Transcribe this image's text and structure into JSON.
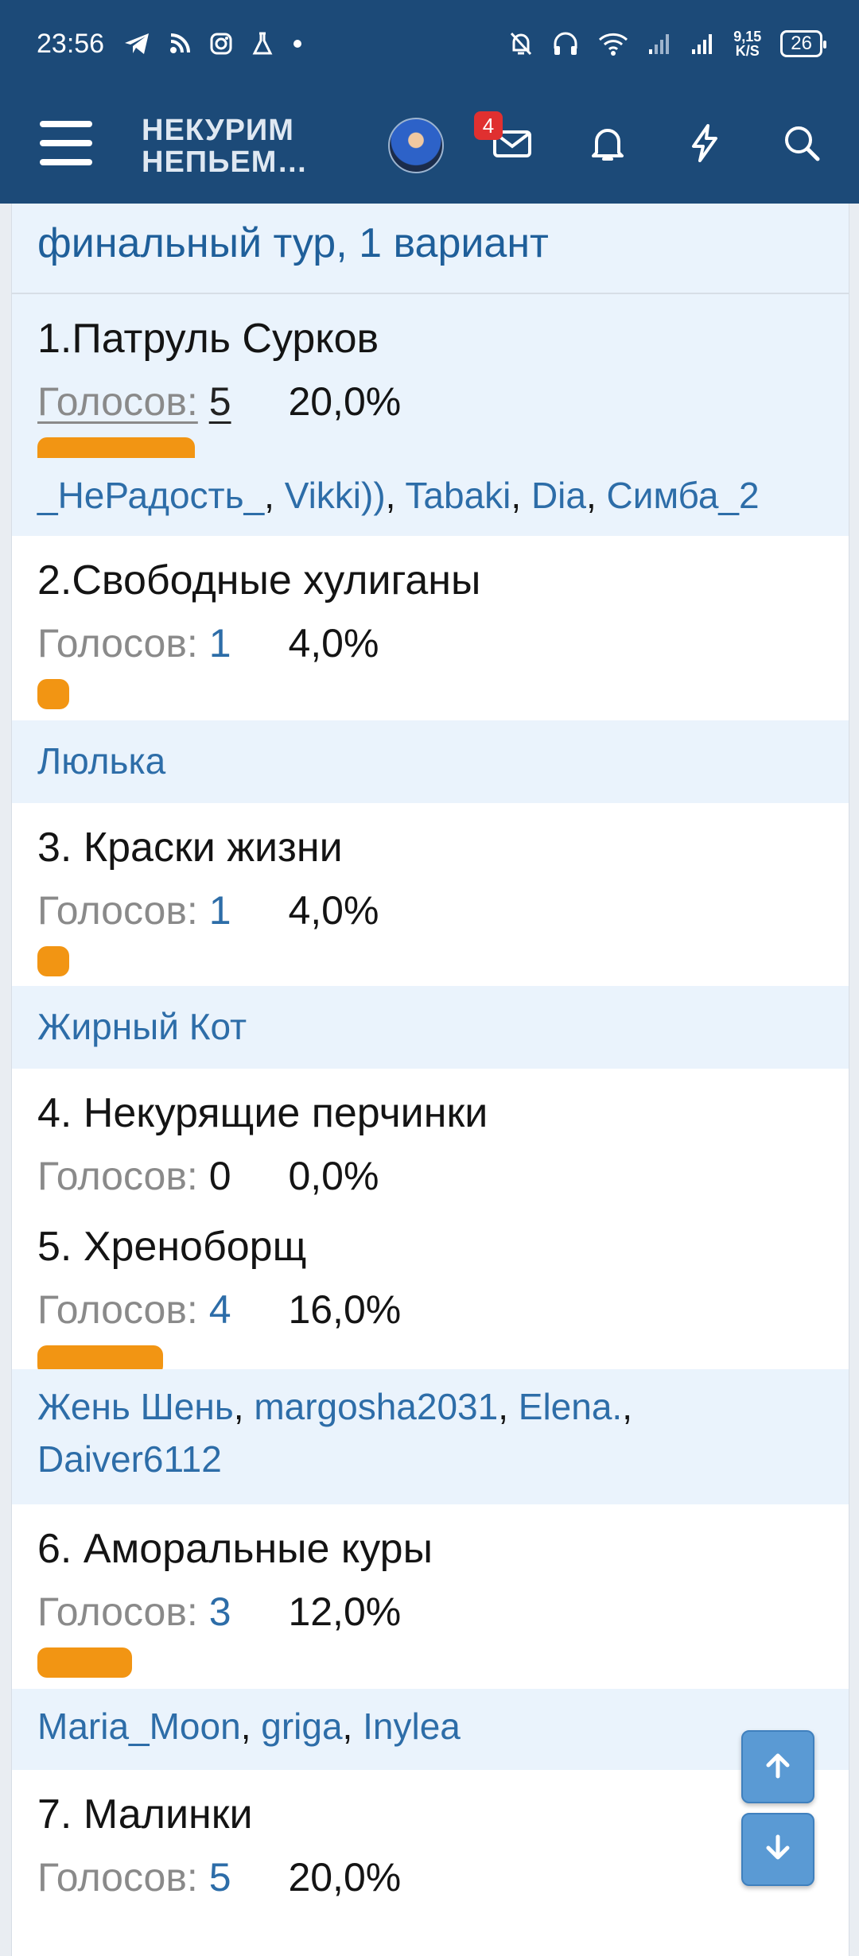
{
  "status_bar": {
    "time": "23:56",
    "net_speed_top": "9,15",
    "net_speed_bottom": "K/S",
    "battery": "26"
  },
  "header": {
    "logo_line1": "НЕКУРИМ",
    "logo_line2": "НЕПЬЕМ…",
    "notification_count": "4"
  },
  "poll": {
    "title": "финальный тур, 1 вариант",
    "votes_label": "Голосов:",
    "options": [
      {
        "name": "1.Патруль Сурков",
        "votes": "5",
        "percent": "20,0%",
        "share": 0.2
      },
      {
        "name": "2.Свободные хулиганы",
        "votes": "1",
        "percent": "4,0%",
        "share": 0.04
      },
      {
        "name": "3. Краски жизни",
        "votes": "1",
        "percent": "4,0%",
        "share": 0.04
      },
      {
        "name": "4. Некурящие перчинки",
        "votes": "0",
        "percent": "0,0%",
        "share": 0.0
      },
      {
        "name": "5. Хреноборщ",
        "votes": "4",
        "percent": "16,0%",
        "share": 0.16
      },
      {
        "name": "6. Аморальные куры",
        "votes": "3",
        "percent": "12,0%",
        "share": 0.12
      },
      {
        "name": "7. Малинки",
        "votes": "5",
        "percent": "20,0%",
        "share": 0.2
      }
    ],
    "voters": {
      "opt1": [
        "_НеРадость_",
        "Vikki))",
        "Tabaki",
        "Dia",
        "Симба_2"
      ],
      "opt2": [
        "Люлька"
      ],
      "opt3": [
        "Жирный Кот"
      ],
      "opt5": [
        "Жень Шень",
        "margosha2031",
        "Elena.",
        "Daiver6112"
      ],
      "opt6": [
        "Maria_Moon",
        "griga",
        "Inylea"
      ]
    }
  },
  "colors": {
    "header_bg": "#1c4a78",
    "bar": "#f29513",
    "link": "#2d6da8",
    "highlight_bg": "#eaf3fc",
    "scroll_button": "#5a9ad4"
  },
  "icons": {
    "menu": "hamburger-icon",
    "messages": "envelope-icon",
    "alerts": "bell-icon",
    "whats_new": "lightning-icon",
    "search": "search-icon",
    "scroll_up": "arrow-up-icon",
    "scroll_down": "arrow-down-icon"
  }
}
